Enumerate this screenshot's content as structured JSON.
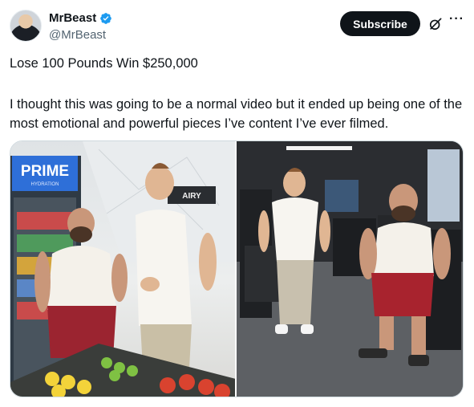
{
  "author": {
    "display_name": "MrBeast",
    "handle": "@MrBeast",
    "verified_color": "#1d9bf0"
  },
  "actions": {
    "subscribe_label": "Subscribe",
    "grok_icon": "grok-icon",
    "more_icon": "more-horizontal-icon",
    "more_glyph": "···"
  },
  "post": {
    "title": "Lose 100 Pounds Win $250,000",
    "body": "I thought this was going to be a normal video but it ended up being one of the most emotional and powerful pieces I’ve content I’ve ever filmed."
  },
  "media": {
    "photo_count": 2,
    "left_photo": {
      "sign_text": "PRIME",
      "sign_subtext": "HYDRATION",
      "fridge_label": "AIRY"
    },
    "right_photo": {}
  },
  "colors": {
    "text_primary": "#0f1419",
    "text_secondary": "#536471",
    "button_bg": "#0f1419",
    "border": "#cfd9de"
  }
}
